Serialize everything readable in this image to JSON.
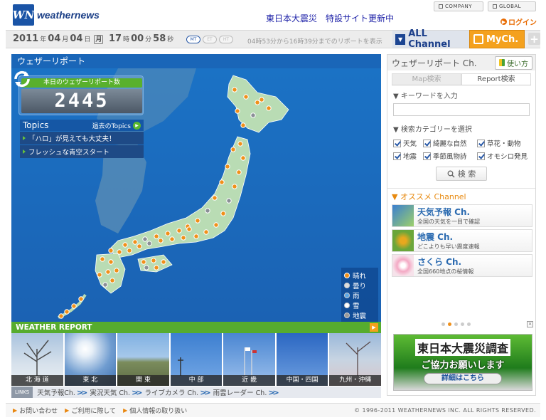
{
  "header": {
    "brand": "weathernews",
    "logo_mark": "WN",
    "notice": "東日本大震災　特設サイト更新中",
    "company": "COMPANY",
    "global": "GLOBAL",
    "login": "ログイン"
  },
  "datebar": {
    "year": "2011",
    "year_unit": "年",
    "month": "04",
    "month_unit": "月",
    "day": "04",
    "day_unit": "日",
    "weekday": "月",
    "hour": "17",
    "hour_unit": "時",
    "minute": "00",
    "minute_unit": "分",
    "second": "58",
    "second_unit": "秒",
    "time_tabs": [
      "MT",
      "ET",
      "HT"
    ],
    "range_text": "04時53分から16時39分までのリポートを表示",
    "all_channel": "ALL Channel",
    "mych": "MyCh.",
    "add": "+"
  },
  "main": {
    "title": "ウェザーリポート",
    "counter_label": "本日のウェザーリポート数",
    "counter_value": "2445",
    "topics_title": "Topics",
    "topics_more": "過去のTopics",
    "topics": [
      "「ハロ」が見えても大丈夫！",
      "フレッシュな青空スタート"
    ],
    "legend": [
      {
        "label": "晴れ",
        "kind": "sun"
      },
      {
        "label": "曇り",
        "kind": "cloud"
      },
      {
        "label": "雨",
        "kind": "rain"
      },
      {
        "label": "雪",
        "kind": "snow"
      },
      {
        "label": "地震",
        "kind": "quake"
      }
    ],
    "weather_report_bar": "WEATHER REPORT",
    "regions": [
      "北 海 道",
      "東 北",
      "関 東",
      "中 部",
      "近 畿",
      "中国・四国",
      "九州・沖縄"
    ],
    "links_label": "LINKS",
    "links": [
      "天気予報Ch.",
      "実況天気 Ch.",
      "ライブカメラ Ch.",
      "雨雲レーダー Ch."
    ]
  },
  "sidebar": {
    "title": "ウェザーリポート Ch.",
    "guide": "使い方",
    "tabs": [
      "Map検索",
      "Report検索"
    ],
    "keyword_label": "▼ キーワードを入力",
    "keyword_value": "",
    "category_label": "▼ 検索カテゴリーを選択",
    "categories": [
      "天気",
      "綺麗な自然",
      "草花・動物",
      "地震",
      "季節風物詩",
      "オモシロ発見"
    ],
    "search_button": "検 索",
    "recommend_title": "▼ オススメ Channel",
    "recommend": [
      {
        "title": "天気予報 Ch.",
        "sub": "全国の天気を一目で確認"
      },
      {
        "title": "地震 Ch.",
        "sub": "どこよりも早い震度速報"
      },
      {
        "title": "さくら Ch.",
        "sub": "全国660地点の桜情報"
      }
    ],
    "close": "×",
    "banner_title": "東日本大震災調査",
    "banner_sub": "ご協力お願いします",
    "banner_button": "詳細はこちら"
  },
  "footer": {
    "links": [
      "お問い合わせ",
      "ご利用に際して",
      "個人情報の取り扱い"
    ],
    "copyright": "© 1996-2011 WEATHERNEWS INC. ALL RIGHTS RESERVED."
  },
  "colors": {
    "brand_blue": "#1a54a6",
    "map_sea": "#1b6abf",
    "accent_green": "#56ac2e",
    "accent_orange": "#f4a11e"
  }
}
